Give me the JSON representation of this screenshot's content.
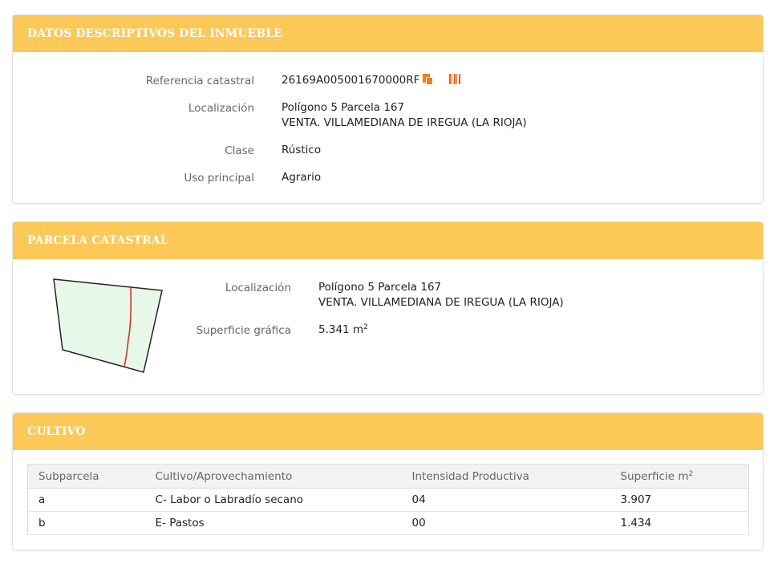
{
  "datos": {
    "title": "DATOS DESCRIPTIVOS DEL INMUEBLE",
    "ref_label": "Referencia catastral",
    "ref_value": "26169A005001670000RF",
    "loc_label": "Localización",
    "loc_line1": "Polígono 5 Parcela 167",
    "loc_line2": "VENTA. VILLAMEDIANA DE IREGUA (LA RIOJA)",
    "clase_label": "Clase",
    "clase_value": "Rústico",
    "uso_label": "Uso principal",
    "uso_value": "Agrario"
  },
  "parcela": {
    "title": "PARCELA CATASTRAL",
    "loc_label": "Localización",
    "loc_line1": "Polígono 5 Parcela 167",
    "loc_line2": "VENTA. VILLAMEDIANA DE IREGUA (LA RIOJA)",
    "sup_label": "Superficie gráfica",
    "sup_value": "5.341 m",
    "sup_unit_exp": "2"
  },
  "cultivo": {
    "title": "CULTIVO",
    "headers": {
      "subparcela": "Subparcela",
      "cultivo": "Cultivo/Aprovechamiento",
      "intensidad": "Intensidad Productiva",
      "superficie": "Superficie m",
      "superficie_exp": "2"
    },
    "rows": [
      {
        "subparcela": "a",
        "cultivo": "C- Labor o Labradío secano",
        "intensidad": "04",
        "superficie": "3.907"
      },
      {
        "subparcela": "b",
        "cultivo": "E- Pastos",
        "intensidad": "00",
        "superficie": "1.434"
      }
    ]
  },
  "colors": {
    "header_bg": "#fcc858",
    "header_text": "#ffffff",
    "icon_accent": "#f07c1a",
    "parcel_fill": "#e8f8e8",
    "parcel_divider": "#d83020"
  },
  "icons": [
    "copy-icon",
    "barcode-icon"
  ]
}
